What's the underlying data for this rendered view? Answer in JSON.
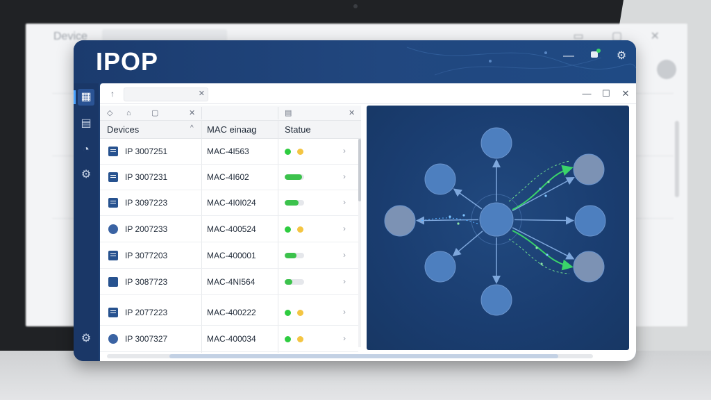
{
  "background_window": {
    "title": "Device",
    "controls": "▭ ▢ ✕"
  },
  "app": {
    "logo": "IPOP",
    "header_icons": [
      "minimize-icon",
      "notification-icon",
      "settings-icon"
    ]
  },
  "rail": {
    "items": [
      "dashboard-icon",
      "file-icon",
      "history-icon",
      "settings-icon"
    ],
    "bottom": "settings-icon"
  },
  "inner_window": {
    "back_label": "↑",
    "address_value": "",
    "minimize": "—",
    "maximize": "☐",
    "close": "✕"
  },
  "table": {
    "columns": [
      "Devices",
      "MAC einaag",
      "Statue"
    ],
    "rows": [
      {
        "ip": "IP 3007251",
        "mac": "MAC-4I563",
        "icon": "doc",
        "status": "dots",
        "dot1": "#2ecc40",
        "dot2": "#f4c542"
      },
      {
        "ip": "IP 3007231",
        "mac": "MAC-4I602",
        "icon": "doc",
        "status": "bar",
        "fill": 0.9,
        "fill_color": "#3cc24c"
      },
      {
        "ip": "IP 3097223",
        "mac": "MAC-4I0I024",
        "icon": "doc",
        "status": "bar",
        "fill": 0.7,
        "fill_color": "#3cc24c"
      },
      {
        "ip": "IP 2007233",
        "mac": "MAC-400524",
        "icon": "circle",
        "status": "dots",
        "dot1": "#2ecc40",
        "dot2": "#f4c542"
      },
      {
        "ip": "IP 3077203",
        "mac": "MAC-400001",
        "icon": "doc",
        "status": "bar",
        "fill": 0.6,
        "fill_color": "#3cc24c"
      },
      {
        "ip": "IP 3087723",
        "mac": "MAC-4NI564",
        "icon": "book",
        "status": "bar",
        "fill": 0.4,
        "fill_color": "#3cc24c"
      },
      {
        "ip": "IP 2077223",
        "mac": "MAC-400222",
        "icon": "doc",
        "status": "dots",
        "dot1": "#2ecc40",
        "dot2": "#f4c542"
      },
      {
        "ip": "IP 3007327",
        "mac": "MAC-400034",
        "icon": "circle",
        "status": "dots",
        "dot1": "#2ecc40",
        "dot2": "#f4c542"
      }
    ]
  },
  "colors": {
    "brand": "#1d3f73",
    "node": "#4d7fbf",
    "link": "#7ea7dc",
    "flow": "#3ad46a"
  }
}
